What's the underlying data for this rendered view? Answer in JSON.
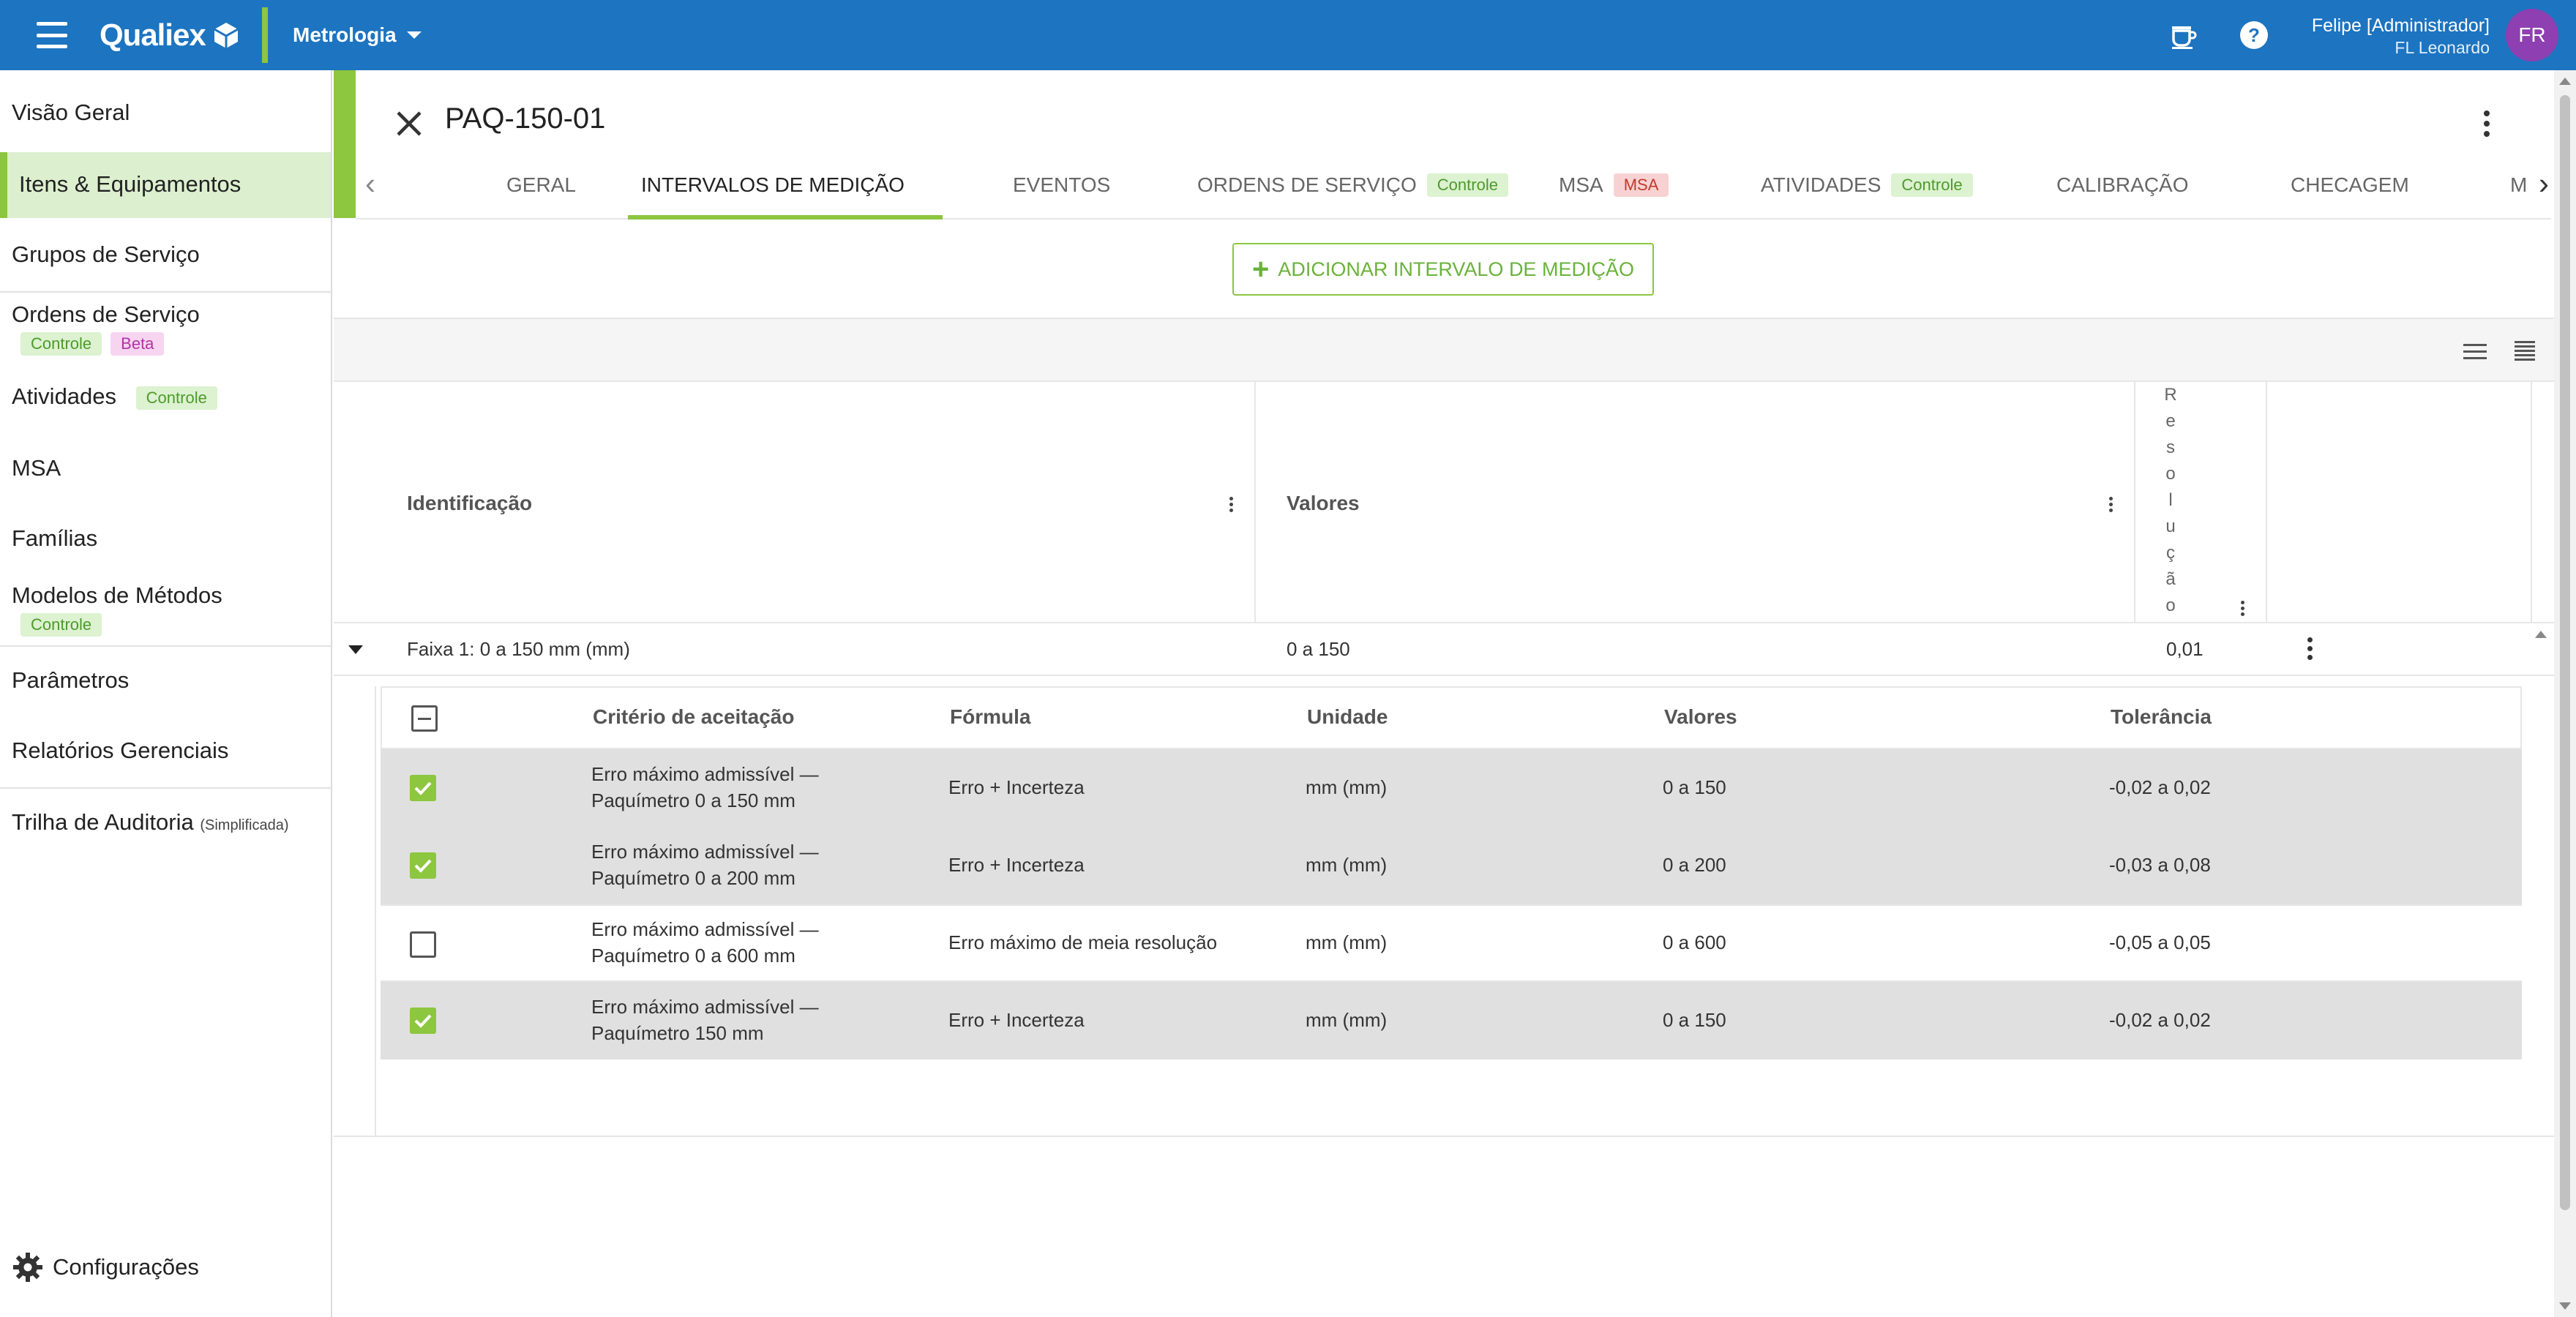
{
  "topbar": {
    "brand": "Qualiex",
    "module": "Metrologia",
    "user_name": "Felipe [Administrador]",
    "user_org": "FL Leonardo",
    "avatar_initials": "FR"
  },
  "sidebar": {
    "items": [
      {
        "label": "Visão Geral"
      },
      {
        "label": "Itens & Equipamentos"
      },
      {
        "label": "Grupos de Serviço"
      },
      {
        "label": "Ordens de Serviço",
        "badges": [
          "Controle",
          "Beta"
        ]
      },
      {
        "label": "Atividades",
        "badges": [
          "Controle"
        ]
      },
      {
        "label": "MSA"
      },
      {
        "label": "Famílias"
      },
      {
        "label": "Modelos de Métodos",
        "badges": [
          "Controle"
        ]
      },
      {
        "label": "Parâmetros"
      },
      {
        "label": "Relatórios Gerenciais"
      },
      {
        "label": "Trilha de Auditoria",
        "suffix": "(Simplificada)"
      }
    ],
    "config_label": "Configurações"
  },
  "detail": {
    "title": "PAQ-150-01",
    "tabs": [
      {
        "label": "GERAL"
      },
      {
        "label": "INTERVALOS DE MEDIÇÃO"
      },
      {
        "label": "EVENTOS"
      },
      {
        "label": "ORDENS DE SERVIÇO",
        "badge": "Controle"
      },
      {
        "label": "MSA",
        "badge": "MSA"
      },
      {
        "label": "ATIVIDADES",
        "badge": "Controle"
      },
      {
        "label": "CALIBRAÇÃO"
      },
      {
        "label": "CHECAGEM"
      },
      {
        "label": "M"
      }
    ],
    "add_button": "ADICIONAR INTERVALO DE MEDIÇÃO"
  },
  "table": {
    "headers": {
      "identificacao": "Identificação",
      "valores": "Valores",
      "resolucao": "Resolução"
    },
    "group": {
      "identificacao": "Faixa 1: 0 a 150 mm (mm)",
      "valores": "0 a 150",
      "resolucao": "0,01"
    },
    "sub_headers": {
      "criterio": "Critério de aceitação",
      "formula": "Fórmula",
      "unidade": "Unidade",
      "valores": "Valores",
      "tolerancia": "Tolerância"
    },
    "rows": [
      {
        "checked": true,
        "criterio_l1": "Erro máximo admissível —",
        "criterio_l2": "Paquímetro 0 a 150 mm",
        "formula": "Erro + Incerteza",
        "unidade": "mm (mm)",
        "valores": "0 a 150",
        "tolerancia": "-0,02 a 0,02"
      },
      {
        "checked": true,
        "criterio_l1": "Erro máximo admissível —",
        "criterio_l2": "Paquímetro 0 a 200 mm",
        "formula": "Erro + Incerteza",
        "unidade": "mm (mm)",
        "valores": "0 a 200",
        "tolerancia": "-0,03 a 0,08"
      },
      {
        "checked": false,
        "criterio_l1": "Erro máximo admissível —",
        "criterio_l2": "Paquímetro 0 a 600 mm",
        "formula": "Erro máximo de meia resolução",
        "unidade": "mm (mm)",
        "valores": "0 a 600",
        "tolerancia": "-0,05 a 0,05"
      },
      {
        "checked": true,
        "criterio_l1": "Erro máximo admissível —",
        "criterio_l2": "Paquímetro 150 mm",
        "formula": "Erro + Incerteza",
        "unidade": "mm (mm)",
        "valores": "0 a 150",
        "tolerancia": "-0,02 a 0,02"
      }
    ]
  },
  "colors": {
    "topbar": "#1d74c0",
    "accent_green": "#8dc63f",
    "avatar": "#8e3fb1",
    "selected_row": "#e0e0e0"
  }
}
